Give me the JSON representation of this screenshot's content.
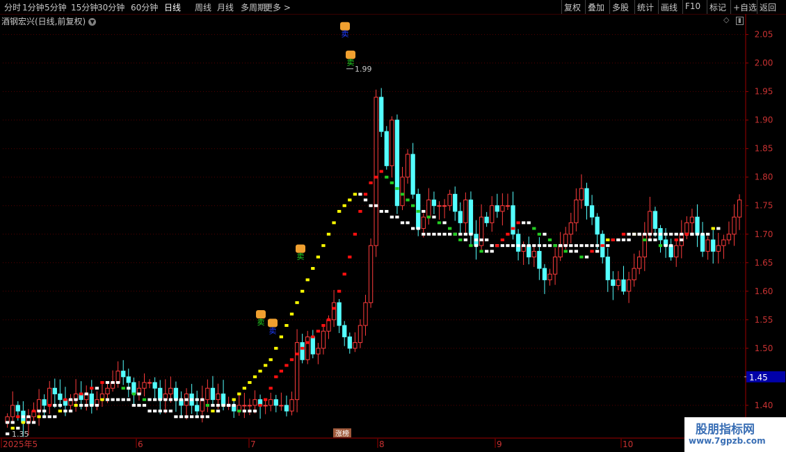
{
  "toolbar": {
    "left_items": [
      "分时",
      "1分钟",
      "5分钟",
      "15分钟",
      "30分钟",
      "60分钟",
      "日线",
      "周线",
      "月线",
      "多周期",
      "更多 >"
    ],
    "active_item": "日线",
    "right_items": [
      "复权",
      "叠加",
      "多股",
      "统计",
      "画线",
      "F10",
      "标记",
      "+自选",
      "返回"
    ]
  },
  "chart_title": "酒钢宏兴(日线,前复权)",
  "chart_data": {
    "type": "candlestick",
    "price_axis": {
      "ticks": [
        "2.05",
        "2.00",
        "1.95",
        "1.90",
        "1.85",
        "1.80",
        "1.75",
        "1.70",
        "1.65",
        "1.60",
        "1.55",
        "1.50",
        "1.45",
        "1.40"
      ],
      "ylim": [
        1.345,
        2.08
      ]
    },
    "current_price_label": "1.45",
    "max_label": "1.99",
    "min_label": "1.35",
    "date_axis": [
      "2025年5",
      "6",
      "7",
      "8",
      "9",
      "10"
    ],
    "center_badge": "涨榜",
    "signals": [
      {
        "text": "卖",
        "label": "sell",
        "color": "#1e3cff",
        "price": 2.045
      },
      {
        "text": "卖",
        "label": "sell",
        "color": "#22cc22",
        "price": 1.995
      },
      {
        "text": "卖",
        "label": "sell",
        "color": "#22cc22",
        "price": 1.655
      },
      {
        "text": "卖",
        "label": "sell",
        "color": "#22cc22",
        "price": 1.54
      },
      {
        "text": "卖",
        "label": "sell",
        "color": "#1e3cff",
        "price": 1.525
      }
    ],
    "candles_close": [
      1.38,
      1.4,
      1.39,
      1.37,
      1.38,
      1.39,
      1.41,
      1.4,
      1.43,
      1.42,
      1.41,
      1.4,
      1.41,
      1.42,
      1.41,
      1.42,
      1.4,
      1.41,
      1.42,
      1.43,
      1.44,
      1.46,
      1.45,
      1.44,
      1.42,
      1.43,
      1.44,
      1.44,
      1.43,
      1.41,
      1.42,
      1.43,
      1.41,
      1.4,
      1.42,
      1.4,
      1.39,
      1.41,
      1.43,
      1.41,
      1.42,
      1.4,
      1.4,
      1.39,
      1.4,
      1.4,
      1.4,
      1.41,
      1.4,
      1.4,
      1.41,
      1.4,
      1.4,
      1.39,
      1.41,
      1.51,
      1.48,
      1.52,
      1.49,
      1.5,
      1.53,
      1.55,
      1.58,
      1.54,
      1.52,
      1.5,
      1.51,
      1.54,
      1.58,
      1.68,
      1.94,
      1.88,
      1.82,
      1.9,
      1.75,
      1.8,
      1.84,
      1.77,
      1.71,
      1.73,
      1.76,
      1.75,
      1.75,
      1.75,
      1.77,
      1.74,
      1.72,
      1.76,
      1.7,
      1.68,
      1.73,
      1.72,
      1.75,
      1.74,
      1.75,
      1.75,
      1.7,
      1.67,
      1.68,
      1.66,
      1.67,
      1.64,
      1.62,
      1.63,
      1.66,
      1.68,
      1.7,
      1.72,
      1.76,
      1.78,
      1.75,
      1.73,
      1.7,
      1.66,
      1.62,
      1.61,
      1.62,
      1.6,
      1.62,
      1.64,
      1.66,
      1.7,
      1.74,
      1.71,
      1.69,
      1.68,
      1.66,
      1.68,
      1.7,
      1.72,
      1.73,
      1.7,
      1.67,
      1.69,
      1.67,
      1.68,
      1.69,
      1.7,
      1.73,
      1.76
    ],
    "ma_fast": [
      1.37,
      1.37,
      1.38,
      1.38,
      1.38,
      1.39,
      1.39,
      1.39,
      1.4,
      1.4,
      1.4,
      1.41,
      1.41,
      1.41,
      1.42,
      1.42,
      1.43,
      1.43,
      1.44,
      1.44,
      1.44,
      1.44,
      1.43,
      1.43,
      1.42,
      1.42,
      1.41,
      1.41,
      1.41,
      1.41,
      1.41,
      1.41,
      1.41,
      1.41,
      1.41,
      1.41,
      1.41,
      1.41,
      1.4,
      1.4,
      1.4,
      1.4,
      1.4,
      1.4,
      1.39,
      1.39,
      1.39,
      1.39,
      1.4,
      1.41,
      1.43,
      1.45,
      1.46,
      1.47,
      1.48,
      1.49,
      1.5,
      1.51,
      1.52,
      1.53,
      1.54,
      1.55,
      1.57,
      1.6,
      1.63,
      1.66,
      1.7,
      1.74,
      1.77,
      1.79,
      1.8,
      1.81,
      1.8,
      1.79,
      1.78,
      1.77,
      1.76,
      1.75,
      1.74,
      1.74,
      1.73,
      1.73,
      1.72,
      1.72,
      1.71,
      1.7,
      1.69,
      1.69,
      1.68,
      1.68,
      1.67,
      1.67,
      1.67,
      1.68,
      1.69,
      1.7,
      1.71,
      1.72,
      1.72,
      1.72,
      1.71,
      1.7,
      1.7,
      1.69,
      1.68,
      1.68,
      1.67,
      1.67,
      1.67,
      1.66,
      1.66,
      1.67,
      1.67,
      1.68,
      1.68,
      1.69,
      1.69,
      1.7,
      1.7,
      1.7,
      1.7,
      1.69,
      1.69,
      1.69,
      1.68,
      1.68,
      1.68,
      1.69,
      1.69,
      1.7,
      1.7
    ],
    "ma_slow": [
      1.35,
      1.36,
      1.36,
      1.37,
      1.37,
      1.37,
      1.38,
      1.38,
      1.38,
      1.38,
      1.39,
      1.39,
      1.39,
      1.4,
      1.4,
      1.4,
      1.4,
      1.4,
      1.41,
      1.41,
      1.41,
      1.41,
      1.41,
      1.41,
      1.4,
      1.4,
      1.4,
      1.39,
      1.39,
      1.39,
      1.39,
      1.39,
      1.38,
      1.38,
      1.38,
      1.38,
      1.38,
      1.38,
      1.38,
      1.39,
      1.39,
      1.4,
      1.4,
      1.41,
      1.42,
      1.43,
      1.44,
      1.45,
      1.46,
      1.47,
      1.48,
      1.5,
      1.52,
      1.54,
      1.56,
      1.58,
      1.6,
      1.62,
      1.64,
      1.66,
      1.68,
      1.7,
      1.72,
      1.74,
      1.75,
      1.76,
      1.77,
      1.77,
      1.76,
      1.75,
      1.75,
      1.74,
      1.74,
      1.73,
      1.73,
      1.72,
      1.72,
      1.71,
      1.71,
      1.7,
      1.7,
      1.7,
      1.7,
      1.7,
      1.7,
      1.7,
      1.7,
      1.7,
      1.7,
      1.69,
      1.69,
      1.69,
      1.68,
      1.68,
      1.68,
      1.68,
      1.68,
      1.68,
      1.68,
      1.68,
      1.68,
      1.68,
      1.68,
      1.68,
      1.68,
      1.68,
      1.68,
      1.68,
      1.68,
      1.68,
      1.68,
      1.68,
      1.68,
      1.68,
      1.69,
      1.69,
      1.69,
      1.69,
      1.69,
      1.7,
      1.7,
      1.7,
      1.7,
      1.7,
      1.7,
      1.7,
      1.7,
      1.7,
      1.7,
      1.7,
      1.7,
      1.7,
      1.7,
      1.7,
      1.71,
      1.71
    ]
  },
  "watermark": {
    "line1": "股朋指标网",
    "line2": "www.7gpzb.com"
  }
}
